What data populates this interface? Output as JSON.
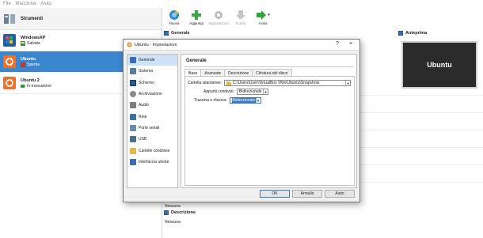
{
  "menubar": {
    "items": [
      "File",
      "Macchina",
      "Aiuto"
    ]
  },
  "left_panel": {
    "tools_label": "Strumenti",
    "vms": [
      {
        "name": "WindowsXP",
        "state": "Salvata"
      },
      {
        "name": "Ubuntu",
        "state": "Spenta"
      },
      {
        "name": "Ubuntu 2",
        "state": "In esecuzione"
      }
    ]
  },
  "toolbar": {
    "buttons": [
      {
        "label": "Nuova"
      },
      {
        "label": "Aggiungi"
      },
      {
        "label": "Impostazioni"
      },
      {
        "label": "Scarta"
      },
      {
        "label": "Avvia"
      }
    ]
  },
  "details": {
    "general_heading": "Generale",
    "preview_heading": "Anteprima",
    "preview_text": "Ubuntu",
    "none_label": "Nessuna",
    "description_heading": "Descrizione",
    "none_label_2": "Nessuna"
  },
  "dialog": {
    "title": "Ubuntu - Impostazioni",
    "help_label": "?",
    "close_label": "×",
    "sidebar": [
      "Generale",
      "Sistema",
      "Schermo",
      "Archiviazione",
      "Audio",
      "Rete",
      "Porte seriali",
      "USB",
      "Cartelle condivise",
      "Interfaccia utente"
    ],
    "section_title": "Generale",
    "tabs": [
      "Base",
      "Avanzate",
      "Descrizione",
      "Cifratura del disco"
    ],
    "fields": {
      "snapshot_label": "Cartella istantanee:",
      "snapshot_value": "C:\\Users\\User\\VirtualBox VMs\\Ubuntu\\Snapshots",
      "clipboard_label": "Appunti condivisi:",
      "clipboard_value": "Bidirezionale",
      "dragdrop_label": "Trascina e rilascia:",
      "dragdrop_value": "Bidirezionale"
    },
    "buttons": {
      "ok": "OK",
      "cancel": "Annulla",
      "help": "Aiuto"
    }
  },
  "colors": {
    "accent": "#3b87cf",
    "selection": "#3b78c2"
  }
}
